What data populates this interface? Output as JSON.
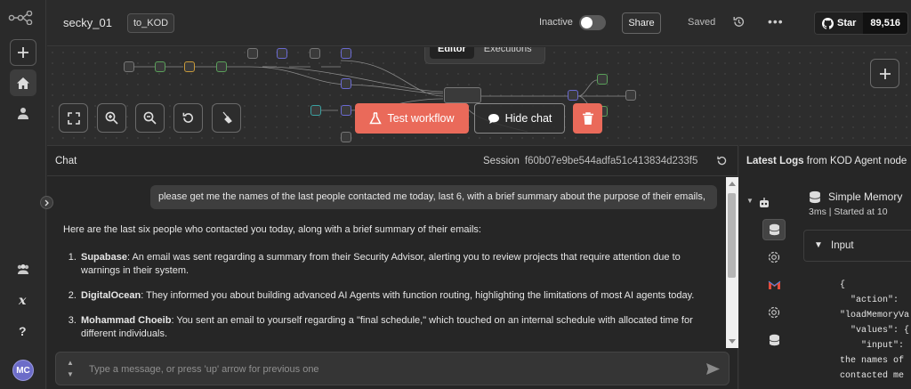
{
  "app": {
    "workflow_name": "secky_01",
    "tag": "to_KOD",
    "status_label": "Inactive",
    "share_label": "Share",
    "saved_label": "Saved",
    "github_star_label": "Star",
    "github_star_count": "89,516",
    "accent_color": "#ea6a5a"
  },
  "canvas": {
    "tabs": [
      {
        "label": "Editor",
        "active": true
      },
      {
        "label": "Executions",
        "active": false
      }
    ],
    "test_workflow_label": "Test workflow",
    "hide_chat_label": "Hide chat"
  },
  "chat": {
    "title": "Chat",
    "session_label": "Session",
    "session_id": "f60b07e9be544adfa51c413834d233f5",
    "user_message": "please get me the names of the last people contacted me today, last 6, with a brief summary about the purpose of their emails,",
    "bot_intro": "Here are the last six people who contacted you today, along with a brief summary of their emails:",
    "items": [
      {
        "num": "1.",
        "name": "Supabase",
        "text": ": An email was sent regarding a summary from their Security Advisor, alerting you to review projects that require attention due to warnings in their system."
      },
      {
        "num": "2.",
        "name": "DigitalOcean",
        "text": ": They informed you about building advanced AI Agents with function routing, highlighting the limitations of most AI agents today."
      },
      {
        "num": "3.",
        "name": "Mohammad Choeib",
        "text": ": You sent an email to yourself regarding a \"final schedule,\" which touched on an internal schedule with allocated time for different individuals."
      }
    ],
    "input_placeholder": "Type a message, or press 'up' arrow for previous one"
  },
  "logs": {
    "title_prefix": "Latest Logs",
    "title_suffix": "from KOD Agent node",
    "node_name": "Simple Memory",
    "duration": "3ms",
    "started": "Started at 10",
    "input_label": "Input",
    "json_lines": [
      "{",
      "  \"action\":",
      "\"loadMemoryVa",
      "  \"values\": {",
      "    \"input\":",
      "the names of",
      "contacted me"
    ]
  }
}
